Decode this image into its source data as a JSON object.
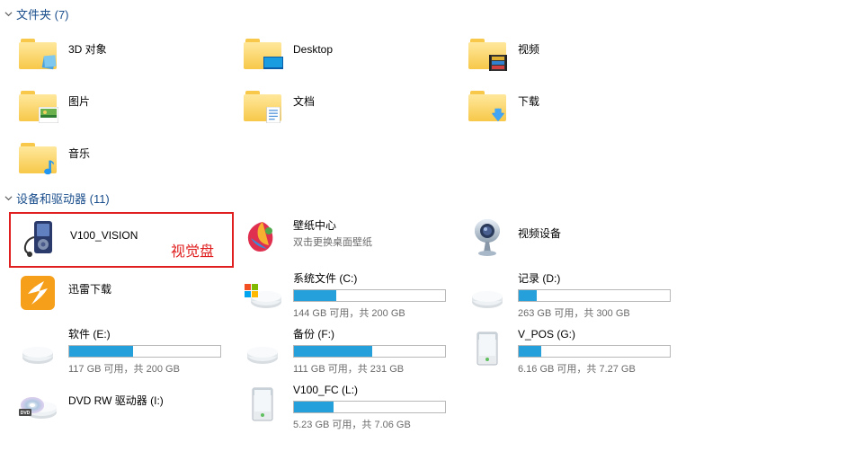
{
  "sections": {
    "folders": {
      "title": "文件夹 (7)"
    },
    "devices": {
      "title": "设备和驱动器 (11)"
    }
  },
  "folders": [
    {
      "label": "3D 对象"
    },
    {
      "label": "Desktop"
    },
    {
      "label": "视频"
    },
    {
      "label": "图片"
    },
    {
      "label": "文档"
    },
    {
      "label": "下载"
    },
    {
      "label": "音乐"
    }
  ],
  "annotation": "视觉盘",
  "devices": {
    "v100_vision": {
      "label": "V100_VISION"
    },
    "wallpaper": {
      "label": "壁纸中心",
      "sub": "双击更换桌面壁纸"
    },
    "videodev": {
      "label": "视频设备"
    },
    "xunlei": {
      "label": "迅雷下载"
    },
    "dvd": {
      "label": "DVD RW 驱动器 (I:)"
    }
  },
  "drives": {
    "c": {
      "label": "系统文件 (C:)",
      "status": "144 GB 可用，共 200 GB",
      "pct": 28
    },
    "d": {
      "label": "记录 (D:)",
      "status": "263 GB 可用，共 300 GB",
      "pct": 12
    },
    "e": {
      "label": "软件 (E:)",
      "status": "117 GB 可用，共 200 GB",
      "pct": 42
    },
    "f": {
      "label": "备份 (F:)",
      "status": "111 GB 可用，共 231 GB",
      "pct": 52
    },
    "g": {
      "label": "V_POS (G:)",
      "status": "6.16 GB 可用，共 7.27 GB",
      "pct": 15
    },
    "l": {
      "label": "V100_FC (L:)",
      "status": "5.23 GB 可用，共 7.06 GB",
      "pct": 26
    }
  }
}
